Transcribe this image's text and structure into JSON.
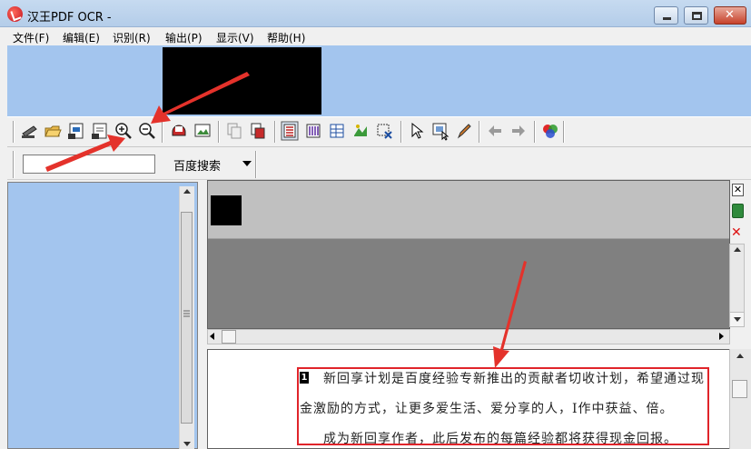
{
  "window": {
    "title": "汉王PDF OCR -",
    "controls": [
      "minimize",
      "maximize",
      "close"
    ]
  },
  "menu": {
    "items": [
      "文件(F)",
      "编辑(E)",
      "识别(R)",
      "输出(P)",
      "显示(V)",
      "帮助(H)"
    ]
  },
  "toolbar": {
    "icons": [
      "scan-icon",
      "open-folder-icon",
      "save-image-icon",
      "save-text-icon",
      "zoom-in-icon",
      "zoom-out-icon",
      "recognize-icon",
      "image-icon",
      "copy-icon",
      "paste-icon",
      "layout-horizontal-icon",
      "layout-vertical-icon",
      "table-icon",
      "picture-region-icon",
      "delete-region-icon",
      "pointer-icon",
      "select-region-icon",
      "pen-icon",
      "back-arrow-icon",
      "forward-arrow-icon",
      "color-icon"
    ]
  },
  "search": {
    "value": "",
    "engine": "百度搜索"
  },
  "document": {
    "line_number": "1",
    "lines": [
      "新回享计划是百度经验专新推出的贡献者切收计划，希望通过现",
      "金激励的方式，让更多爱生活、爱分享的人，I作中获益、倍。",
      "成为新回享作者，此后发布的每篇经验都将获得现金回报。"
    ]
  },
  "colors": {
    "accent_blue": "#a3c5ee",
    "highlight_red": "#e0242a",
    "arrow_red": "#e4322b"
  }
}
